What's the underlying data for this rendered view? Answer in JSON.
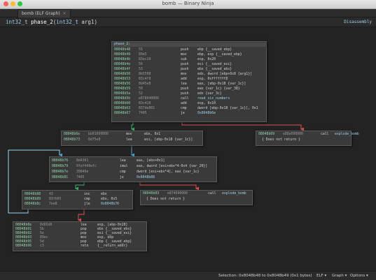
{
  "window": {
    "title": "bomb — Binary Ninja"
  },
  "tab": {
    "label": "bomb (ELF Graph)"
  },
  "signature": {
    "ret_type": "int32_t",
    "name": "phase_2",
    "open": "(",
    "arg_type": "int32_t",
    "arg_name": "arg1",
    "close": ")"
  },
  "view_mode": "Disassembly",
  "blocks": [
    {
      "label": "phase_2:",
      "rows": [
        [
          "08048b48",
          "55",
          "push",
          "ebp {__saved_ebp}"
        ],
        [
          "08048b49",
          "89e5",
          "mov",
          "ebp, esp {__saved_ebp}"
        ],
        [
          "08048b4b",
          "83ec20",
          "sub",
          "esp, 0x20"
        ],
        [
          "08048b4e",
          "56",
          "push",
          "esi {__saved_esi}"
        ],
        [
          "08048b4f",
          "53",
          "push",
          "ebx {__saved_ebx}"
        ],
        [
          "08048b50",
          "8b5508",
          "mov",
          "edx, dword [ebp+0x8 {arg1}]"
        ],
        [
          "08048b53",
          "83c4f8",
          "add",
          "esp, 0xfffffff8"
        ],
        [
          "08048b56",
          "8d45e8",
          "lea",
          "eax, [ebp-0x18 {var_1c}]"
        ],
        [
          "08048b59",
          "50",
          "push",
          "eax {var_1c} {var_38}"
        ],
        [
          "08048b5a",
          "52",
          "push",
          "edx {var_3c}"
        ],
        [
          "08048b5b",
          "e878040000",
          "call",
          "read_six_numbers"
        ],
        [
          "08048b60",
          "83c410",
          "add",
          "esp, 0x10"
        ],
        [
          "08048b63",
          "837de801",
          "cmp",
          "dword [ebp-0x18 {var_1c}], 0x1"
        ],
        [
          "08048b67",
          "7405",
          "je",
          "0x8048b6e"
        ]
      ]
    },
    {
      "rows": [
        [
          "08048b6e",
          "bb01000000",
          "mov",
          "ebx, 0x1"
        ],
        [
          "08048b73",
          "8d75e8",
          "lea",
          "esi, [ebp-0x18 {var_1c}]"
        ]
      ]
    },
    {
      "rows": [
        [
          "08048b69",
          "e88e090000",
          "call",
          "explode_bomb"
        ],
        [
          "",
          "",
          "",
          "{ Does not return }"
        ]
      ]
    },
    {
      "rows": [
        [
          "08048b76",
          "8d4301",
          "lea",
          "eax, [ebx+0x1]"
        ],
        [
          "08048b79",
          "0faf449efc",
          "imul",
          "eax, dword [esi+ebx*4-0x4 {var_20}]"
        ],
        [
          "08048b7e",
          "39049e",
          "cmp",
          "dword [esi+ebx*4], eax {var_1c}"
        ],
        [
          "08048b81",
          "7405",
          "je",
          "0x8048b88"
        ]
      ]
    },
    {
      "rows": [
        [
          "08048b88",
          "43",
          "inc",
          "ebx"
        ],
        [
          "08048b89",
          "83fb05",
          "cmp",
          "ebx, 0x5"
        ],
        [
          "08048b8c",
          "7ee8",
          "jle",
          "0x8048b76"
        ]
      ]
    },
    {
      "rows": [
        [
          "08048b83",
          "e874090000",
          "call",
          "explode_bomb"
        ],
        [
          "",
          "",
          "",
          "{ Does not return }"
        ]
      ]
    },
    {
      "rows": [
        [
          "08048b8e",
          "8d65d8",
          "lea",
          "esp, [ebp-0x28]"
        ],
        [
          "08048b91",
          "5b",
          "pop",
          "ebx {__saved_ebx}"
        ],
        [
          "08048b92",
          "5e",
          "pop",
          "esi {__saved_esi}"
        ],
        [
          "08048b93",
          "89ec",
          "mov",
          "esp, ebp"
        ],
        [
          "08048b95",
          "5d",
          "pop",
          "ebp {__saved_ebp}"
        ],
        [
          "08048b96",
          "c3",
          "retn",
          "{__return_addr}"
        ]
      ]
    }
  ],
  "status": {
    "selection": "Selection: 0x8048b48 to 0x8048b49 (0x1 bytes)",
    "arch": "ELF ▾",
    "view": "Graph ▾",
    "options": "Options ▾"
  },
  "colors": {
    "address": "#8fd3a6",
    "edge_true": "#3fae6a",
    "edge_false": "#d9534f",
    "edge_unconditional": "#4fa3d1",
    "loop_back": "#9ad7f0"
  }
}
